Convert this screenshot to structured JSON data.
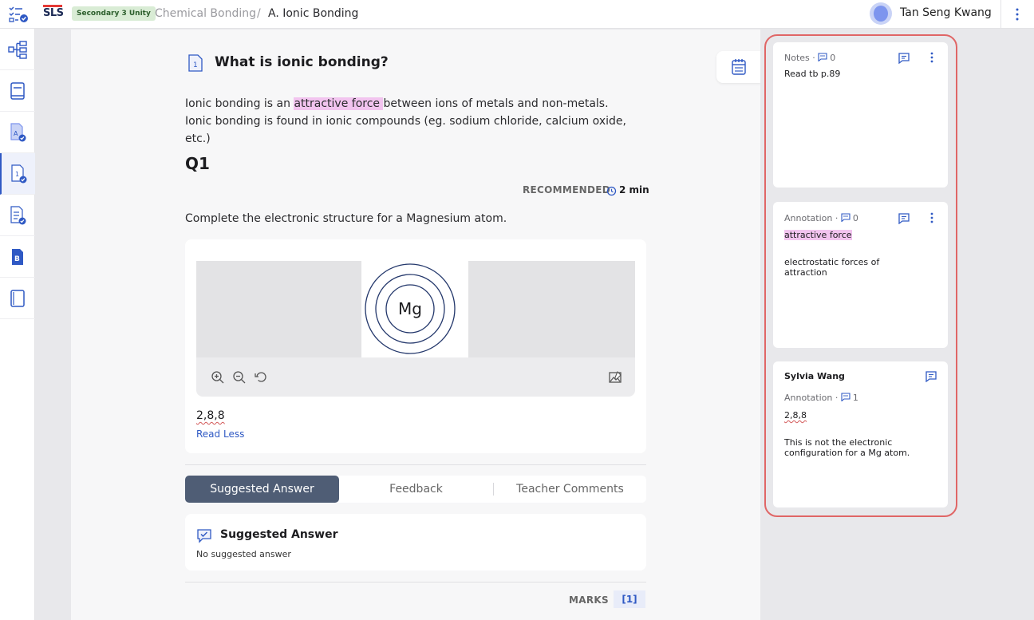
{
  "app": {
    "logo": "SLS",
    "class_badge": "Secondary 3 Unity",
    "breadcrumb": [
      "Chemical Bonding",
      "A. Ionic Bonding"
    ],
    "breadcrumb_sep": "/",
    "user_name": "Tan Seng Kwang"
  },
  "sidebar": {
    "items": [
      "checklist-icon",
      "flow-map-icon",
      "book-icon",
      "activity-a-icon",
      "activity-1-icon",
      "activity-check-icon",
      "activity-b-icon",
      "summary-book-icon"
    ],
    "active_index": 4
  },
  "content": {
    "title": "What is ionic bonding?",
    "intro_before": "Ionic bonding is an ",
    "intro_highlight": "attractive force ",
    "intro_after": "between ions of metals and non-metals. Ionic bonding is found in ionic compounds (eg. sodium chloride, calcium oxide, etc.)",
    "question_label": "Q1",
    "recommended_label": "RECOMMENDED",
    "duration": "2 min",
    "prompt": "Complete the electronic structure for a Magnesium atom.",
    "diagram_label": "Mg",
    "answer_text": "2,8,8",
    "read_less": "Read Less",
    "tabs": [
      "Suggested Answer",
      "Feedback",
      "Teacher Comments"
    ],
    "active_tab": 0,
    "suggested_title": "Suggested Answer",
    "suggested_body": "No suggested answer",
    "marks_label": "MARKS",
    "marks_value": "[1]"
  },
  "notes_panel": {
    "cards": [
      {
        "type_label": "Notes",
        "count": "0",
        "body": "Read tb p.89"
      },
      {
        "type_label": "Annotation",
        "count": "0",
        "quote": "attractive force",
        "body": "electrostatic forces of attraction"
      },
      {
        "author": "Sylvia Wang",
        "type_label": "Annotation",
        "count": "1",
        "quote": "2,8,8",
        "body": "This is not the electronic configuration for a Mg atom."
      }
    ]
  },
  "colors": {
    "accent": "#2f59c4",
    "highlight": "#f2c4ef",
    "active_tab": "#4f5d75",
    "panel_frame": "#e06666"
  }
}
